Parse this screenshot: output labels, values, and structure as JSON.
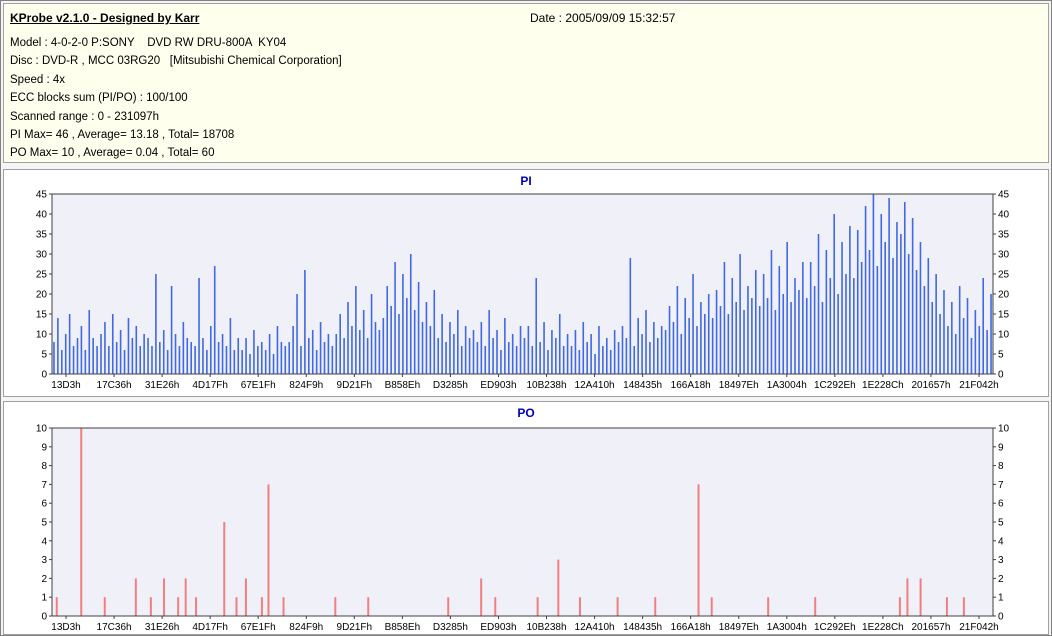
{
  "header": {
    "app_title": "KProbe v2.1.0 - Designed by Karr",
    "date_label": "Date : 2005/09/09 15:32:57"
  },
  "info": {
    "lines": [
      "Model : 4-0-2-0 P:SONY    DVD RW DRU-800A  KY04",
      "Disc : DVD-R , MCC 03RG20   [Mitsubishi Chemical Corporation]",
      "Speed : 4x",
      "ECC blocks sum (PI/PO) : 100/100",
      "Scanned range : 0 - 231097h",
      "PI Max= 46 , Average= 13.18 , Total= 18708",
      "PO Max= 10 , Average= 0.04 , Total= 60"
    ]
  },
  "colors": {
    "info_bg": "#ffffee",
    "panel_bg": "#ffffff",
    "plot_bg": "#f0f0f8",
    "axis": "#404040",
    "chart_title": "#0000bb",
    "pi_bar": "#4169e1",
    "po_bar": "#f08080"
  },
  "chart_data": [
    {
      "type": "bar",
      "title": "PI",
      "ylabel": "",
      "xlabel": "",
      "ylim": [
        0,
        45
      ],
      "yticks": [
        0,
        5,
        10,
        15,
        20,
        25,
        30,
        35,
        40,
        45
      ],
      "x_labels": [
        "13D3h",
        "17C36h",
        "31E26h",
        "4D17Fh",
        "67E1Fh",
        "824F9h",
        "9D21Fh",
        "B858Eh",
        "D3285h",
        "ED903h",
        "10B238h",
        "12A410h",
        "148435h",
        "166A18h",
        "18497Eh",
        "1A3004h",
        "1C292Eh",
        "1E228Ch",
        "201657h",
        "21F042h"
      ],
      "bar_color": "#4169e1",
      "stats": {
        "max": 46,
        "average": 13.18,
        "total": 18708
      },
      "values": [
        8,
        14,
        6,
        10,
        15,
        7,
        9,
        12,
        6,
        16,
        9,
        7,
        10,
        13,
        7,
        15,
        8,
        11,
        6,
        14,
        9,
        12,
        7,
        10,
        9,
        7,
        25,
        8,
        11,
        6,
        22,
        10,
        7,
        13,
        9,
        8,
        7,
        24,
        9,
        6,
        12,
        27,
        8,
        10,
        7,
        14,
        6,
        9,
        6,
        9,
        5,
        11,
        7,
        8,
        6,
        10,
        5,
        12,
        8,
        7,
        8,
        12,
        20,
        7,
        26,
        9,
        11,
        6,
        13,
        8,
        10,
        7,
        10,
        15,
        9,
        18,
        12,
        22,
        11,
        16,
        9,
        20,
        13,
        11,
        14,
        22,
        17,
        28,
        15,
        25,
        19,
        30,
        16,
        23,
        13,
        18,
        12,
        21,
        9,
        15,
        8,
        13,
        10,
        16,
        7,
        12,
        9,
        11,
        8,
        13,
        7,
        16,
        9,
        11,
        6,
        14,
        8,
        10,
        7,
        12,
        9,
        12,
        7,
        24,
        8,
        13,
        6,
        11,
        9,
        15,
        7,
        10,
        7,
        11,
        6,
        13,
        8,
        10,
        5,
        12,
        7,
        9,
        6,
        11,
        8,
        12,
        9,
        29,
        7,
        14,
        10,
        16,
        8,
        13,
        9,
        12,
        11,
        17,
        13,
        22,
        10,
        19,
        14,
        25,
        12,
        18,
        15,
        20,
        14,
        21,
        17,
        28,
        15,
        24,
        18,
        30,
        16,
        22,
        19,
        26,
        17,
        25,
        19,
        31,
        16,
        27,
        20,
        33,
        18,
        24,
        21,
        28,
        19,
        28,
        22,
        35,
        18,
        31,
        24,
        40,
        20,
        33,
        25,
        37,
        24,
        36,
        28,
        42,
        31,
        45,
        27,
        40,
        33,
        44,
        29,
        38,
        35,
        43,
        30,
        39,
        26,
        33,
        22,
        29,
        18,
        25,
        15,
        21,
        12,
        18,
        10,
        22,
        14,
        19,
        9,
        16,
        12,
        24,
        11,
        20
      ]
    },
    {
      "type": "bar",
      "title": "PO",
      "ylabel": "",
      "xlabel": "",
      "ylim": [
        0,
        10
      ],
      "yticks": [
        0,
        1,
        2,
        3,
        4,
        5,
        6,
        7,
        8,
        9,
        10
      ],
      "x_labels": [
        "13D3h",
        "17C36h",
        "31E26h",
        "4D17Fh",
        "67E1Fh",
        "824F9h",
        "9D21Fh",
        "B858Eh",
        "D3285h",
        "ED903h",
        "10B238h",
        "12A410h",
        "148435h",
        "166A18h",
        "18497Eh",
        "1A3004h",
        "1C292Eh",
        "1E228Ch",
        "201657h",
        "21F042h"
      ],
      "bar_color": "#f08080",
      "stats": {
        "max": 10,
        "average": 0.04,
        "total": 60
      },
      "points": [
        [
          0.004,
          1
        ],
        [
          0.03,
          10
        ],
        [
          0.055,
          1
        ],
        [
          0.088,
          2
        ],
        [
          0.104,
          1
        ],
        [
          0.118,
          2
        ],
        [
          0.133,
          1
        ],
        [
          0.141,
          2
        ],
        [
          0.152,
          1
        ],
        [
          0.182,
          5
        ],
        [
          0.195,
          1
        ],
        [
          0.205,
          2
        ],
        [
          0.222,
          1
        ],
        [
          0.229,
          7
        ],
        [
          0.245,
          1
        ],
        [
          0.3,
          1
        ],
        [
          0.335,
          1
        ],
        [
          0.42,
          1
        ],
        [
          0.455,
          2
        ],
        [
          0.47,
          1
        ],
        [
          0.515,
          1
        ],
        [
          0.537,
          3
        ],
        [
          0.56,
          1
        ],
        [
          0.6,
          1
        ],
        [
          0.64,
          1
        ],
        [
          0.686,
          7
        ],
        [
          0.7,
          1
        ],
        [
          0.76,
          1
        ],
        [
          0.81,
          1
        ],
        [
          0.9,
          1
        ],
        [
          0.908,
          2
        ],
        [
          0.922,
          2
        ],
        [
          0.95,
          1
        ],
        [
          0.968,
          1
        ]
      ]
    }
  ]
}
